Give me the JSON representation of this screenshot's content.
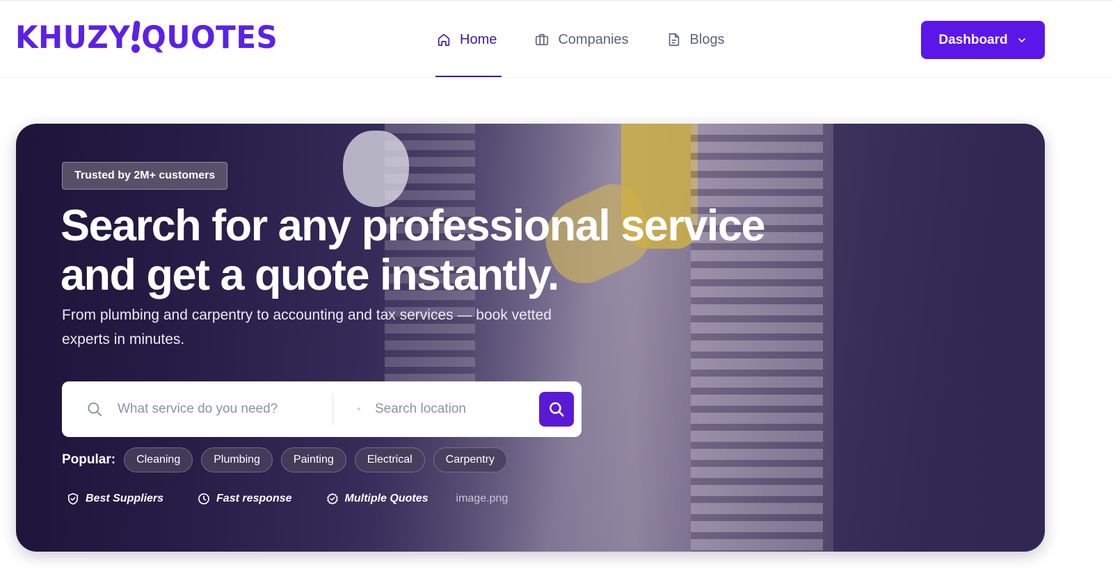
{
  "brand": {
    "logo_left": "KHUZY",
    "logo_right": "QUOTES",
    "color": "#5b21e6"
  },
  "nav": {
    "items": [
      {
        "label": "Home",
        "icon": "home-icon",
        "active": true
      },
      {
        "label": "Companies",
        "icon": "briefcase-icon",
        "active": false
      },
      {
        "label": "Blogs",
        "icon": "document-icon",
        "active": false
      }
    ]
  },
  "dashboard": {
    "label": "Dashboard",
    "icon": "chevron-down-icon",
    "color": "#5b16e8"
  },
  "hero": {
    "badge": "Trusted by 2M+ customers",
    "headline_1": "Search for any professional service",
    "headline_2": "and get a quote instantly.",
    "subtitle": "From plumbing and carpentry to accounting and tax services — book vetted experts in minutes."
  },
  "search": {
    "service_placeholder": "What service do you need?",
    "location_placeholder": "Search location",
    "service_value": "",
    "location_value": "",
    "button_color": "#5a1ad4"
  },
  "popular": {
    "label": "Popular:",
    "chips": [
      "Cleaning",
      "Plumbing",
      "Painting",
      "Electrical",
      "Carpentry"
    ]
  },
  "features": [
    {
      "label": "Best Suppliers",
      "icon": "shield-check-icon"
    },
    {
      "label": "Fast response",
      "icon": "clock-icon"
    },
    {
      "label": "Multiple Quotes",
      "icon": "badge-check-icon"
    }
  ],
  "broken_image_alt": "image.png"
}
